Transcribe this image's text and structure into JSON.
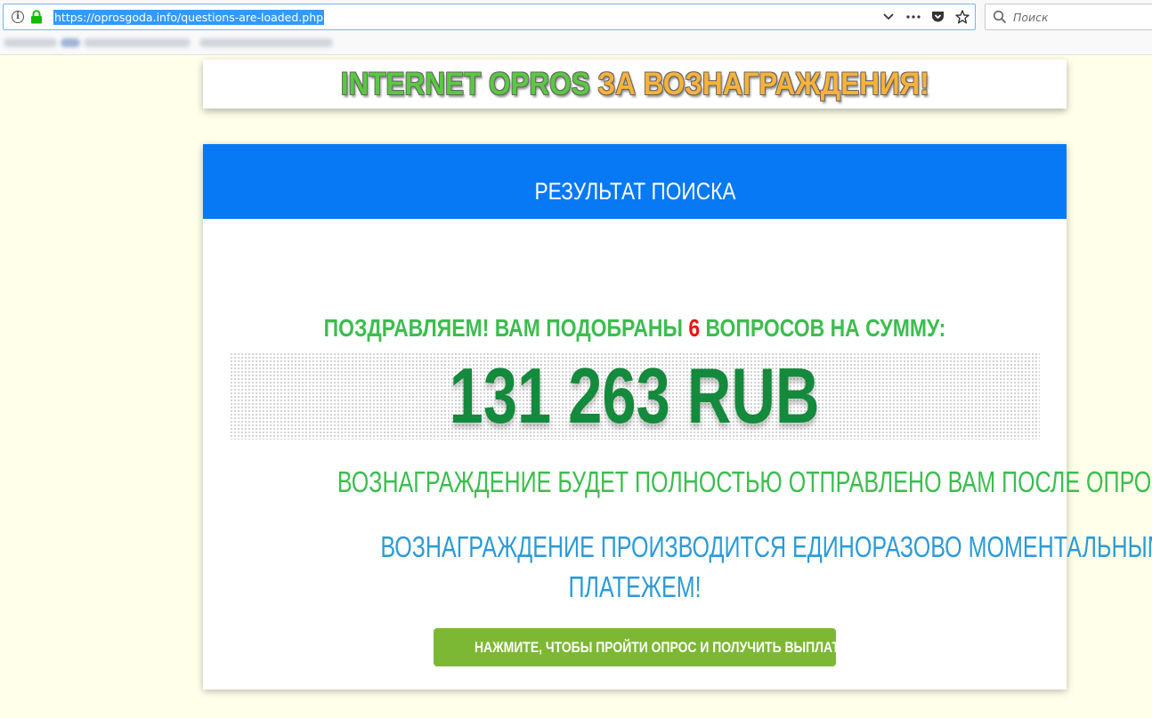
{
  "browser": {
    "url": "https://oprosgoda.info/questions-are-loaded.php",
    "search_placeholder": "Поиск",
    "colors": {
      "url_highlight": "#3399ff",
      "lock": "#12bc00"
    }
  },
  "banner": {
    "title_part1": "INTERNET OPROS ",
    "title_part2": "ЗА ВОЗНАГРАЖДЕНИЯ!",
    "colors": {
      "part1": "#5ac842",
      "part2": "#f8b23a"
    }
  },
  "card": {
    "header": "РЕЗУЛЬТАТ ПОИСКА",
    "congrats_prefix": "ПОЗДРАВЛЯЕМ! ВАМ ПОДОБРАНЫ ",
    "question_count": "6",
    "congrats_suffix": " ВОПРОСОВ НА СУММУ:",
    "amount": "131 263 RUB",
    "reward_sent": "ВОЗНАГРАЖДЕНИЕ БУДЕТ ПОЛНОСТЬЮ ОТПРАВЛЕНО ВАМ ПОСЛЕ ОПРОСА.",
    "reward_once_line1": "ВОЗНАГРАЖДЕНИЕ ПРОИЗВОДИТСЯ ЕДИНОРАЗОВО МОМЕНТАЛЬНЫМ",
    "reward_once_line2": "ПЛАТЕЖЕМ!",
    "cta_label": "НАЖМИТЕ, ЧТОБЫ ПРОЙТИ ОПРОС И ПОЛУЧИТЬ ВЫПЛАТУ",
    "colors": {
      "header_bg": "#0879f4",
      "green_text": "#3cbd4f",
      "amount": "#138a3c",
      "highlight_number": "#ee1111",
      "blue_text": "#2b9bd6",
      "cta_bg": "#7db834"
    }
  },
  "icons": [
    "info-icon",
    "lock-icon",
    "chevron-down-icon",
    "more-icon",
    "pocket-icon",
    "star-icon",
    "search-icon"
  ]
}
